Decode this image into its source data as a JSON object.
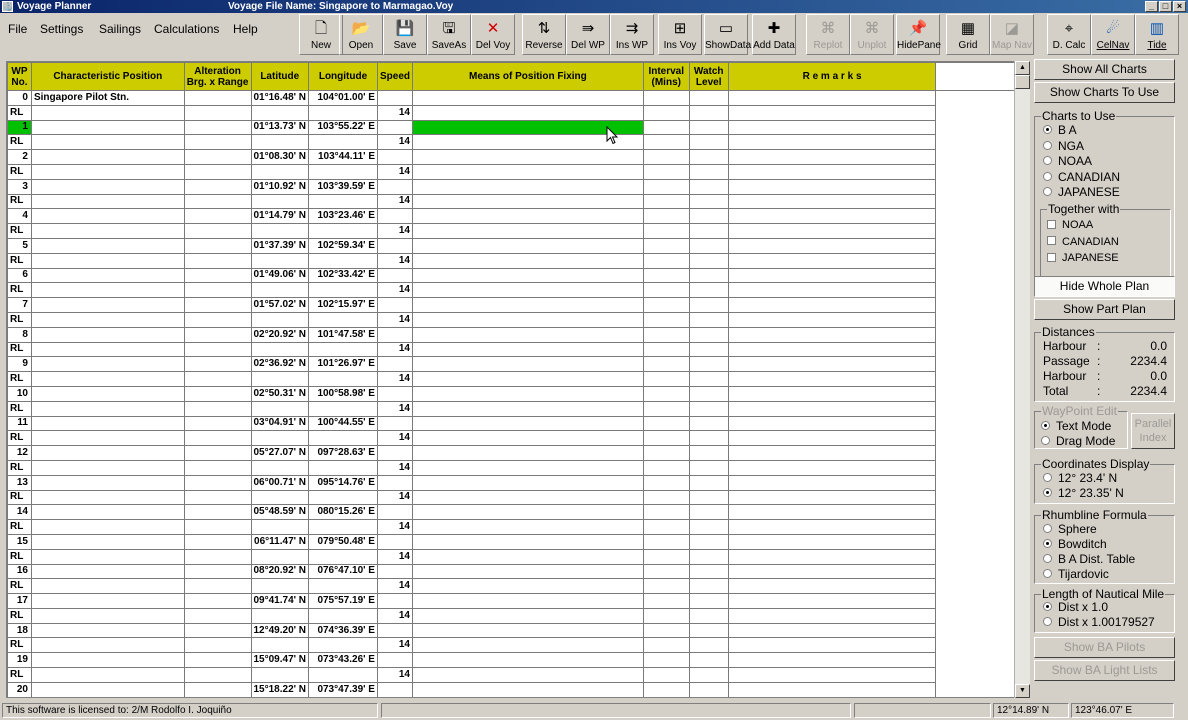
{
  "window": {
    "app_title": "Voyage Planner",
    "file_title": "Voyage File Name:  Singapore to Marmagao.Voy",
    "min": "_",
    "max": "□",
    "close": "×"
  },
  "menu": [
    "File",
    "Settings",
    "Sailings",
    "Calculations",
    "Help"
  ],
  "toolbar": [
    {
      "label": "New",
      "icon": "new-file-icon",
      "glyph": "🗋",
      "enabled": true
    },
    {
      "label": "Open",
      "icon": "open-folder-icon",
      "glyph": "📂",
      "enabled": true
    },
    {
      "label": "Save",
      "icon": "save-disk-icon",
      "glyph": "💾",
      "enabled": true
    },
    {
      "label": "SaveAs",
      "icon": "save-as-icon",
      "glyph": "🖫",
      "enabled": true
    },
    {
      "label": "Del Voy",
      "icon": "delete-x-icon",
      "glyph": "✕",
      "enabled": true
    },
    {
      "label": "Reverse",
      "icon": "reverse-icon",
      "glyph": "⇅",
      "enabled": true
    },
    {
      "label": "Del WP",
      "icon": "delete-waypoint-icon",
      "glyph": "⇛",
      "enabled": true
    },
    {
      "label": "Ins WP",
      "icon": "insert-waypoint-icon",
      "glyph": "⇉",
      "enabled": true
    },
    {
      "label": "Ins Voy",
      "icon": "insert-voyage-icon",
      "glyph": "⊞",
      "enabled": true
    },
    {
      "label": "ShowData",
      "icon": "show-data-icon",
      "glyph": "▭",
      "enabled": true
    },
    {
      "label": "Add Data",
      "icon": "add-data-icon",
      "glyph": "✚",
      "enabled": true
    },
    {
      "label": "Replot",
      "icon": "replot-icon",
      "glyph": "⌘",
      "enabled": false
    },
    {
      "label": "Unplot",
      "icon": "unplot-icon",
      "glyph": "⌘",
      "enabled": false
    },
    {
      "label": "HidePane",
      "icon": "pushpin-icon",
      "glyph": "📌",
      "enabled": true
    },
    {
      "label": "Grid",
      "icon": "grid-icon",
      "glyph": "▦",
      "enabled": true
    },
    {
      "label": "Map Nav",
      "icon": "map-nav-icon",
      "glyph": "◪",
      "enabled": false
    },
    {
      "label": "D. Calc",
      "icon": "crosshair-icon",
      "glyph": "⌖",
      "enabled": true
    },
    {
      "label": "CelNav",
      "icon": "celestial-nav-icon",
      "glyph": "☄",
      "enabled": true
    },
    {
      "label": "Tide",
      "icon": "tide-icon",
      "glyph": "▥",
      "enabled": true
    }
  ],
  "grid": {
    "headers": [
      "WP No.",
      "Characteristic Position",
      "Alteration Brg. x Range",
      "Latitude",
      "Longitude",
      "Speed",
      "Means of Position Fixing",
      "Interval (Mins)",
      "Watch Level",
      "R e m a r k s"
    ],
    "rows": [
      {
        "wp": "0",
        "name": "Singapore Pilot Stn.",
        "lat": "01°16.48' N",
        "lon": "104°01.00' E"
      },
      {
        "rl": "RL",
        "speed": "14"
      },
      {
        "wp": "1",
        "name": "",
        "lat": "01°13.73' N",
        "lon": "103°55.22' E",
        "selected": true
      },
      {
        "rl": "RL",
        "speed": "14"
      },
      {
        "wp": "2",
        "name": "",
        "lat": "01°08.30' N",
        "lon": "103°44.11' E"
      },
      {
        "rl": "RL",
        "speed": "14"
      },
      {
        "wp": "3",
        "name": "",
        "lat": "01°10.92' N",
        "lon": "103°39.59' E"
      },
      {
        "rl": "RL",
        "speed": "14"
      },
      {
        "wp": "4",
        "name": "",
        "lat": "01°14.79' N",
        "lon": "103°23.46' E"
      },
      {
        "rl": "RL",
        "speed": "14"
      },
      {
        "wp": "5",
        "name": "",
        "lat": "01°37.39' N",
        "lon": "102°59.34' E"
      },
      {
        "rl": "RL",
        "speed": "14"
      },
      {
        "wp": "6",
        "name": "",
        "lat": "01°49.06' N",
        "lon": "102°33.42' E"
      },
      {
        "rl": "RL",
        "speed": "14"
      },
      {
        "wp": "7",
        "name": "",
        "lat": "01°57.02' N",
        "lon": "102°15.97' E"
      },
      {
        "rl": "RL",
        "speed": "14"
      },
      {
        "wp": "8",
        "name": "",
        "lat": "02°20.92' N",
        "lon": "101°47.58' E"
      },
      {
        "rl": "RL",
        "speed": "14"
      },
      {
        "wp": "9",
        "name": "",
        "lat": "02°36.92' N",
        "lon": "101°26.97' E"
      },
      {
        "rl": "RL",
        "speed": "14"
      },
      {
        "wp": "10",
        "name": "",
        "lat": "02°50.31' N",
        "lon": "100°58.98' E"
      },
      {
        "rl": "RL",
        "speed": "14"
      },
      {
        "wp": "11",
        "name": "",
        "lat": "03°04.91' N",
        "lon": "100°44.55' E"
      },
      {
        "rl": "RL",
        "speed": "14"
      },
      {
        "wp": "12",
        "name": "",
        "lat": "05°27.07' N",
        "lon": "097°28.63' E"
      },
      {
        "rl": "RL",
        "speed": "14"
      },
      {
        "wp": "13",
        "name": "",
        "lat": "06°00.71' N",
        "lon": "095°14.76' E"
      },
      {
        "rl": "RL",
        "speed": "14"
      },
      {
        "wp": "14",
        "name": "",
        "lat": "05°48.59' N",
        "lon": "080°15.26' E"
      },
      {
        "rl": "RL",
        "speed": "14"
      },
      {
        "wp": "15",
        "name": "",
        "lat": "06°11.47' N",
        "lon": "079°50.48' E"
      },
      {
        "rl": "RL",
        "speed": "14"
      },
      {
        "wp": "16",
        "name": "",
        "lat": "08°20.92' N",
        "lon": "076°47.10' E"
      },
      {
        "rl": "RL",
        "speed": "14"
      },
      {
        "wp": "17",
        "name": "",
        "lat": "09°41.74' N",
        "lon": "075°57.19' E"
      },
      {
        "rl": "RL",
        "speed": "14"
      },
      {
        "wp": "18",
        "name": "",
        "lat": "12°49.20' N",
        "lon": "074°36.39' E"
      },
      {
        "rl": "RL",
        "speed": "14"
      },
      {
        "wp": "19",
        "name": "",
        "lat": "15°09.47' N",
        "lon": "073°43.26' E"
      },
      {
        "rl": "RL",
        "speed": "14"
      },
      {
        "wp": "20",
        "name": "",
        "lat": "15°18.22' N",
        "lon": "073°47.39' E"
      }
    ],
    "selected_cell_color": "#00c000",
    "header_color": "#cccc00"
  },
  "panel": {
    "show_all_charts": "Show All Charts",
    "show_charts_to_use": "Show Charts To Use",
    "charts_to_use": {
      "title": "Charts to Use",
      "options": [
        "B A",
        "NGA",
        "NOAA",
        "CANADIAN",
        "JAPANESE"
      ],
      "selected": "B A",
      "together_title": "Together with",
      "together_options": [
        "NOAA",
        "CANADIAN",
        "JAPANESE"
      ]
    },
    "hide_whole_plan": "Hide Whole Plan",
    "show_part_plan": "Show Part Plan",
    "distances": {
      "title": "Distances",
      "rows": [
        {
          "label": "Harbour",
          "value": "0.0"
        },
        {
          "label": "Passage",
          "value": "2234.4"
        },
        {
          "label": "Harbour",
          "value": "0.0"
        },
        {
          "label": "Total",
          "value": "2234.4"
        }
      ]
    },
    "waypoint_edit": {
      "title": "WayPoint Edit",
      "options": [
        "Text Mode",
        "Drag Mode"
      ],
      "selected": "Text Mode",
      "parallel_index": "Parallel Index"
    },
    "coordinates_display": {
      "title": "Coordinates Display",
      "options": [
        "12° 23.4' N",
        "12° 23.35' N"
      ],
      "selected": "12° 23.35' N"
    },
    "rhumbline_formula": {
      "title": "Rhumbline Formula",
      "options": [
        "Sphere",
        "Bowditch",
        "B A Dist. Table",
        "Tijardovic"
      ],
      "selected": "Bowditch"
    },
    "nautical_mile": {
      "title": "Length of Nautical Mile",
      "options": [
        "Dist x 1.0",
        "Dist x 1.00179527"
      ],
      "selected": "Dist x 1.0"
    },
    "show_ba_pilots": "Show BA Pilots",
    "show_ba_light_lists": "Show BA Light Lists"
  },
  "status": {
    "license": "This software is licensed to: 2/M Rodolfo I. Joquiño",
    "lat": "12°14.89' N",
    "lon": "123°46.07' E"
  }
}
